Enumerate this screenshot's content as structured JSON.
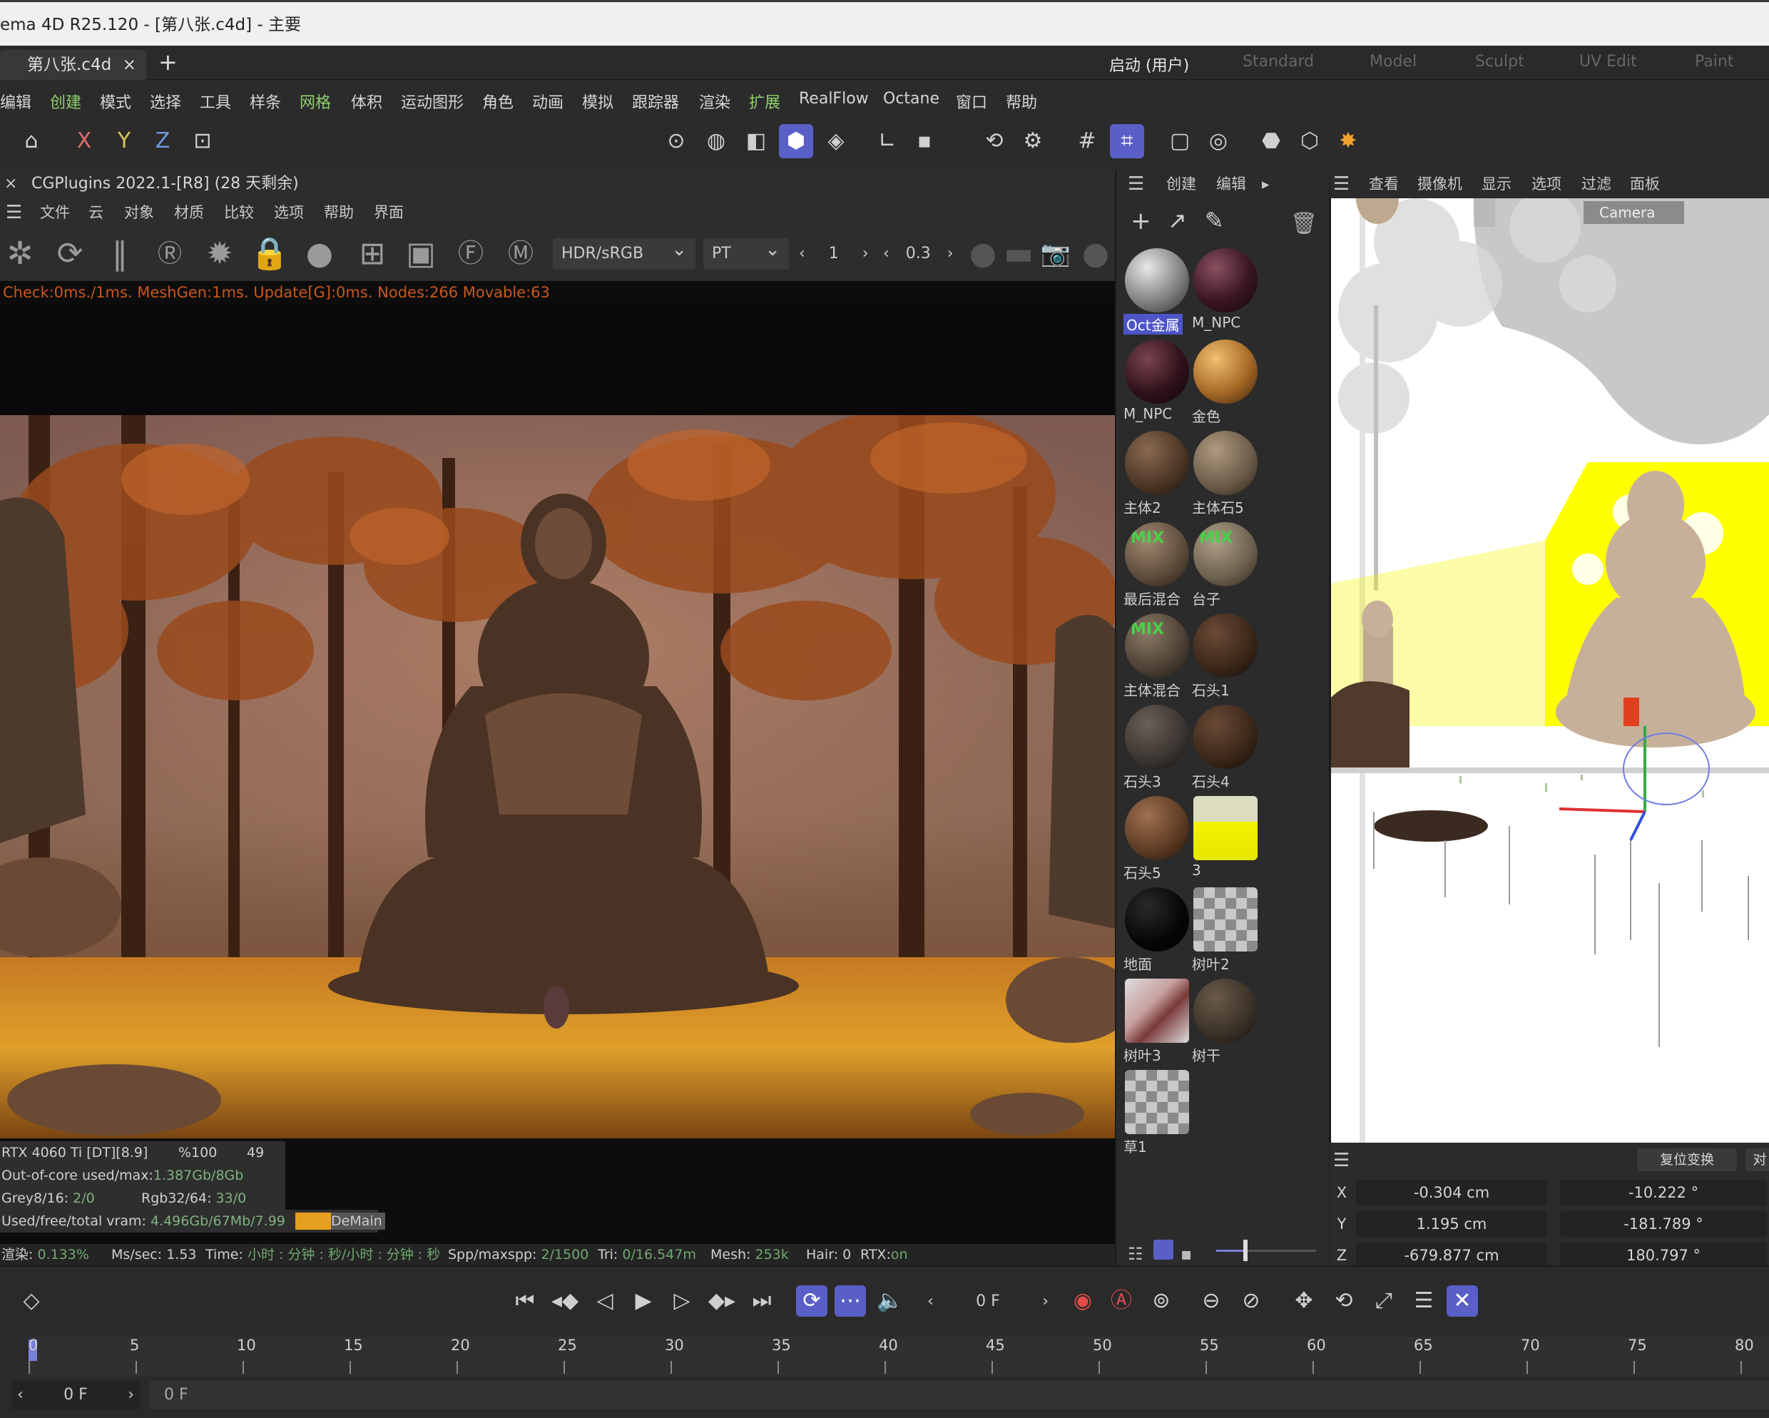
{
  "window": {
    "title": "ema 4D R25.120 - [第八张.c4d] - 主要"
  },
  "doc_tab": {
    "label": "第八张.c4d",
    "close": "×",
    "add": "+"
  },
  "layouts": [
    "启动 (用户)",
    "Standard",
    "Model",
    "Sculpt",
    "UV Edit",
    "Paint"
  ],
  "menu": [
    "编辑",
    "创建",
    "模式",
    "选择",
    "工具",
    "样条",
    "网格",
    "体积",
    "运动图形",
    "角色",
    "动画",
    "模拟",
    "跟踪器",
    "渲染",
    "扩展",
    "RealFlow",
    "Octane",
    "窗口",
    "帮助"
  ],
  "toolbar_axes": [
    "X",
    "Y",
    "Z"
  ],
  "octane": {
    "header": "CGPlugins   2022.1-[R8] (28 天剩余)",
    "close": "×",
    "menu": [
      "文件",
      "云",
      "对象",
      "材质",
      "比较",
      "选项",
      "帮助",
      "界面"
    ],
    "color_mode": "HDR/sRGB",
    "kernel": "PT",
    "value1": "1",
    "value2": "0.3",
    "stats": "Check:0ms./1ms. MeshGen:1ms. Update[G]:0ms. Nodes:266 Movable:63",
    "info": {
      "gpu_label": "RTX 4060 Ti [DT][8.9]",
      "gpu_pct": "%100",
      "gpu_temp": "49",
      "ooc_label": "Out-of-core used/max:",
      "ooc_value": "1.387Gb/8Gb",
      "grey_label": "Grey8/16:",
      "grey_value": "2/0",
      "rgb_label": "Rgb32/64:",
      "rgb_value": "33/0",
      "vram_label": "Used/free/total vram:",
      "vram_value": "4.496Gb/67Mb/7.99",
      "vram_tag": "DeMain"
    },
    "render_stats": {
      "progress_label": "渲染:",
      "progress_value": "0.133%",
      "ms_label": "Ms/sec:",
      "ms_value": "1.53",
      "time_label": "Time:",
      "time_value": "小时 : 分钟 : 秒/小时 : 分钟 : 秒",
      "spp_label": "Spp/maxspp:",
      "spp_value": "2/1500",
      "tri_label": "Tri:",
      "tri_value": "0/16.547m",
      "mesh_label": "Mesh:",
      "mesh_value": "253k",
      "hair_label": "Hair:",
      "hair_value": "0",
      "rtx_label": "RTX:",
      "rtx_value": "on"
    }
  },
  "material_panel": {
    "menu": [
      "创建",
      "编辑"
    ],
    "materials": [
      {
        "name": "Oct金属",
        "selected": true,
        "kind": "metal"
      },
      {
        "name": "M_NPC",
        "kind": "darkred"
      },
      {
        "name": "M_NPC",
        "kind": "darkred2"
      },
      {
        "name": "金色",
        "kind": "gold"
      },
      {
        "name": "主体2",
        "kind": "brown"
      },
      {
        "name": "主体石5",
        "kind": "tan"
      },
      {
        "name": "最后混合",
        "kind": "mix1"
      },
      {
        "name": "台子",
        "kind": "mix2"
      },
      {
        "name": "主体混合",
        "kind": "mix3"
      },
      {
        "name": "石头1",
        "kind": "darkbrown"
      },
      {
        "name": "石头3",
        "kind": "stone"
      },
      {
        "name": "石头4",
        "kind": "darkbrown"
      },
      {
        "name": "石头5",
        "kind": "brown2"
      },
      {
        "name": "3",
        "kind": "yellow"
      },
      {
        "name": "地面",
        "kind": "black"
      },
      {
        "name": "树叶2",
        "kind": "checker"
      },
      {
        "name": "树叶3",
        "kind": "leaves"
      },
      {
        "name": "树干",
        "kind": "bark"
      },
      {
        "name": "草1",
        "kind": "checker"
      }
    ],
    "mix_label": "MIX"
  },
  "viewport": {
    "menu": [
      "查看",
      "摄像机",
      "显示",
      "选项",
      "过滤",
      "面板"
    ],
    "camera_label": "Camera"
  },
  "coordinates": {
    "buttons": [
      "复位变换",
      "对"
    ],
    "rows": [
      {
        "axis": "X",
        "pos": "-0.304 cm",
        "rot": "-10.222 °"
      },
      {
        "axis": "Y",
        "pos": "1.195 cm",
        "rot": "-181.789 °"
      },
      {
        "axis": "Z",
        "pos": "-679.877 cm",
        "rot": "180.797 °"
      }
    ]
  },
  "timeline": {
    "current_frame": "0 F",
    "start_frame": "0 F",
    "end_frame": "0 F",
    "ticks": [
      "0",
      "5",
      "10",
      "15",
      "20",
      "25",
      "30",
      "35",
      "40",
      "45",
      "50",
      "55",
      "60",
      "65",
      "70",
      "75",
      "80"
    ],
    "accent": "#5a5fc7"
  },
  "colors": {
    "accent": "#5a5fc7",
    "layout_underline": "#4a7fc7",
    "menu_green": "#8fd06c",
    "stats_orange": "#c8571e"
  }
}
